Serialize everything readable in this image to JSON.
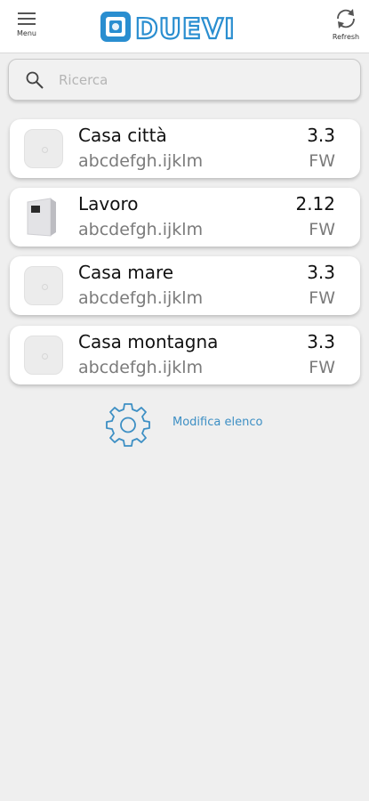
{
  "header": {
    "menu_label": "Menu",
    "refresh_label": "Refresh",
    "logo_text": "DUEVI",
    "brand_color": "#2a8ed0",
    "icons": {
      "menu": "hamburger-icon",
      "refresh": "refresh-icon",
      "logo": "duevi-logo"
    }
  },
  "search": {
    "placeholder": "Ricerca",
    "value": "",
    "icon": "search-icon"
  },
  "devices": [
    {
      "name": "Casa città",
      "serial": "abcdefgh.ijklm",
      "version": "3.3",
      "fw_label": "FW",
      "thumb": "device-thumb-generic"
    },
    {
      "name": "Lavoro",
      "serial": "abcdefgh.ijklm",
      "version": "2.12",
      "fw_label": "FW",
      "thumb": "device-thumb-panel"
    },
    {
      "name": "Casa mare",
      "serial": "abcdefgh.ijklm",
      "version": "3.3",
      "fw_label": "FW",
      "thumb": "device-thumb-generic"
    },
    {
      "name": "Casa montagna",
      "serial": "abcdefgh.ijklm",
      "version": "3.3",
      "fw_label": "FW",
      "thumb": "device-thumb-generic"
    }
  ],
  "edit": {
    "label": "Modifica elenco",
    "icon": "gear-icon",
    "color": "#3d8fc4"
  }
}
